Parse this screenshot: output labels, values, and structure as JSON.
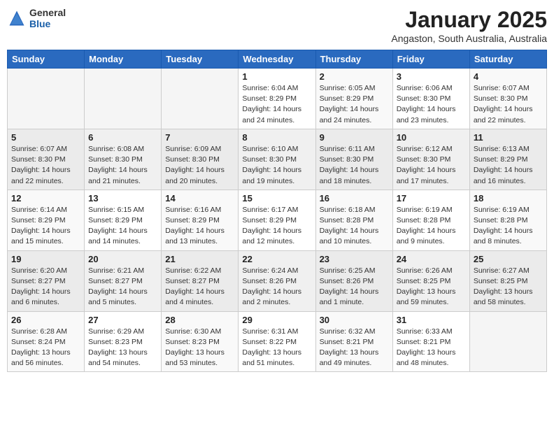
{
  "header": {
    "logo_general": "General",
    "logo_blue": "Blue",
    "month": "January 2025",
    "location": "Angaston, South Australia, Australia"
  },
  "days_of_week": [
    "Sunday",
    "Monday",
    "Tuesday",
    "Wednesday",
    "Thursday",
    "Friday",
    "Saturday"
  ],
  "weeks": [
    [
      {
        "num": "",
        "info": ""
      },
      {
        "num": "",
        "info": ""
      },
      {
        "num": "",
        "info": ""
      },
      {
        "num": "1",
        "info": "Sunrise: 6:04 AM\nSunset: 8:29 PM\nDaylight: 14 hours\nand 24 minutes."
      },
      {
        "num": "2",
        "info": "Sunrise: 6:05 AM\nSunset: 8:29 PM\nDaylight: 14 hours\nand 24 minutes."
      },
      {
        "num": "3",
        "info": "Sunrise: 6:06 AM\nSunset: 8:30 PM\nDaylight: 14 hours\nand 23 minutes."
      },
      {
        "num": "4",
        "info": "Sunrise: 6:07 AM\nSunset: 8:30 PM\nDaylight: 14 hours\nand 22 minutes."
      }
    ],
    [
      {
        "num": "5",
        "info": "Sunrise: 6:07 AM\nSunset: 8:30 PM\nDaylight: 14 hours\nand 22 minutes."
      },
      {
        "num": "6",
        "info": "Sunrise: 6:08 AM\nSunset: 8:30 PM\nDaylight: 14 hours\nand 21 minutes."
      },
      {
        "num": "7",
        "info": "Sunrise: 6:09 AM\nSunset: 8:30 PM\nDaylight: 14 hours\nand 20 minutes."
      },
      {
        "num": "8",
        "info": "Sunrise: 6:10 AM\nSunset: 8:30 PM\nDaylight: 14 hours\nand 19 minutes."
      },
      {
        "num": "9",
        "info": "Sunrise: 6:11 AM\nSunset: 8:30 PM\nDaylight: 14 hours\nand 18 minutes."
      },
      {
        "num": "10",
        "info": "Sunrise: 6:12 AM\nSunset: 8:30 PM\nDaylight: 14 hours\nand 17 minutes."
      },
      {
        "num": "11",
        "info": "Sunrise: 6:13 AM\nSunset: 8:29 PM\nDaylight: 14 hours\nand 16 minutes."
      }
    ],
    [
      {
        "num": "12",
        "info": "Sunrise: 6:14 AM\nSunset: 8:29 PM\nDaylight: 14 hours\nand 15 minutes."
      },
      {
        "num": "13",
        "info": "Sunrise: 6:15 AM\nSunset: 8:29 PM\nDaylight: 14 hours\nand 14 minutes."
      },
      {
        "num": "14",
        "info": "Sunrise: 6:16 AM\nSunset: 8:29 PM\nDaylight: 14 hours\nand 13 minutes."
      },
      {
        "num": "15",
        "info": "Sunrise: 6:17 AM\nSunset: 8:29 PM\nDaylight: 14 hours\nand 12 minutes."
      },
      {
        "num": "16",
        "info": "Sunrise: 6:18 AM\nSunset: 8:28 PM\nDaylight: 14 hours\nand 10 minutes."
      },
      {
        "num": "17",
        "info": "Sunrise: 6:19 AM\nSunset: 8:28 PM\nDaylight: 14 hours\nand 9 minutes."
      },
      {
        "num": "18",
        "info": "Sunrise: 6:19 AM\nSunset: 8:28 PM\nDaylight: 14 hours\nand 8 minutes."
      }
    ],
    [
      {
        "num": "19",
        "info": "Sunrise: 6:20 AM\nSunset: 8:27 PM\nDaylight: 14 hours\nand 6 minutes."
      },
      {
        "num": "20",
        "info": "Sunrise: 6:21 AM\nSunset: 8:27 PM\nDaylight: 14 hours\nand 5 minutes."
      },
      {
        "num": "21",
        "info": "Sunrise: 6:22 AM\nSunset: 8:27 PM\nDaylight: 14 hours\nand 4 minutes."
      },
      {
        "num": "22",
        "info": "Sunrise: 6:24 AM\nSunset: 8:26 PM\nDaylight: 14 hours\nand 2 minutes."
      },
      {
        "num": "23",
        "info": "Sunrise: 6:25 AM\nSunset: 8:26 PM\nDaylight: 14 hours\nand 1 minute."
      },
      {
        "num": "24",
        "info": "Sunrise: 6:26 AM\nSunset: 8:25 PM\nDaylight: 13 hours\nand 59 minutes."
      },
      {
        "num": "25",
        "info": "Sunrise: 6:27 AM\nSunset: 8:25 PM\nDaylight: 13 hours\nand 58 minutes."
      }
    ],
    [
      {
        "num": "26",
        "info": "Sunrise: 6:28 AM\nSunset: 8:24 PM\nDaylight: 13 hours\nand 56 minutes."
      },
      {
        "num": "27",
        "info": "Sunrise: 6:29 AM\nSunset: 8:23 PM\nDaylight: 13 hours\nand 54 minutes."
      },
      {
        "num": "28",
        "info": "Sunrise: 6:30 AM\nSunset: 8:23 PM\nDaylight: 13 hours\nand 53 minutes."
      },
      {
        "num": "29",
        "info": "Sunrise: 6:31 AM\nSunset: 8:22 PM\nDaylight: 13 hours\nand 51 minutes."
      },
      {
        "num": "30",
        "info": "Sunrise: 6:32 AM\nSunset: 8:21 PM\nDaylight: 13 hours\nand 49 minutes."
      },
      {
        "num": "31",
        "info": "Sunrise: 6:33 AM\nSunset: 8:21 PM\nDaylight: 13 hours\nand 48 minutes."
      },
      {
        "num": "",
        "info": ""
      }
    ]
  ]
}
